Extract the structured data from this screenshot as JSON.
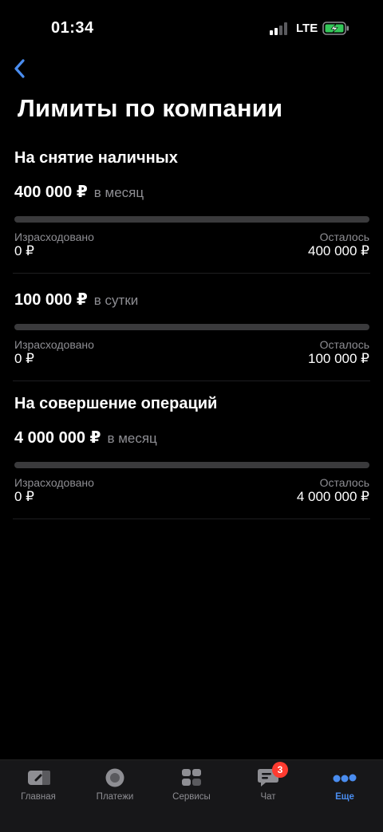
{
  "status_bar": {
    "time": "01:34",
    "network": "LTE",
    "battery_charging": true
  },
  "header": {
    "back_icon": "chevron-left-icon",
    "title": "Лимиты по компании"
  },
  "sections": [
    {
      "title": "На снятие наличных",
      "limits": [
        {
          "amount": "400 000 ₽",
          "period": "в месяц",
          "used_fraction": 0,
          "spent_label": "Израсходовано",
          "spent": "0 ₽",
          "remaining_label": "Осталось",
          "remaining": "400 000 ₽"
        },
        {
          "amount": "100 000 ₽",
          "period": "в сутки",
          "used_fraction": 0,
          "spent_label": "Израсходовано",
          "spent": "0 ₽",
          "remaining_label": "Осталось",
          "remaining": "100 000 ₽"
        }
      ]
    },
    {
      "title": "На совершение операций",
      "limits": [
        {
          "amount": "4 000 000 ₽",
          "period": "в месяц",
          "used_fraction": 0,
          "spent_label": "Израсходовано",
          "spent": "0 ₽",
          "remaining_label": "Осталось",
          "remaining": "4 000 000 ₽"
        }
      ]
    }
  ],
  "tab_bar": {
    "tabs": [
      {
        "label": "Главная",
        "icon": "home-card-icon",
        "active": false
      },
      {
        "label": "Платежи",
        "icon": "payments-circle-icon",
        "active": false
      },
      {
        "label": "Сервисы",
        "icon": "services-grid-icon",
        "active": false
      },
      {
        "label": "Чат",
        "icon": "chat-icon",
        "active": false,
        "badge": "3"
      },
      {
        "label": "Еще",
        "icon": "more-dots-icon",
        "active": true
      }
    ]
  },
  "colors": {
    "accent": "#4a8df0",
    "background": "#000000",
    "secondary_text": "#8e8e93",
    "badge": "#ff3b30"
  }
}
